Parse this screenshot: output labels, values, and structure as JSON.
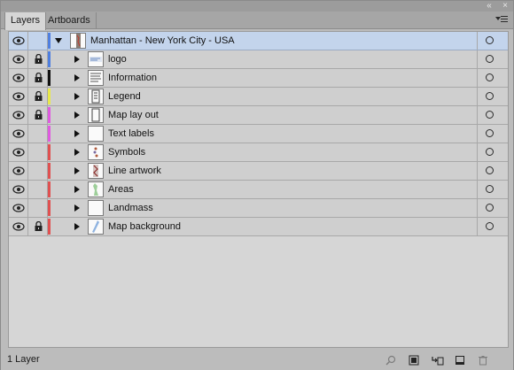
{
  "tabs": [
    {
      "label": "Layers",
      "active": true
    },
    {
      "label": "Artboards",
      "active": false
    }
  ],
  "title_buttons": {
    "collapse": "«",
    "close": "×"
  },
  "layers": [
    {
      "name": "Manhattan - New York City - USA",
      "visible": true,
      "locked": false,
      "color": "#4f7fe0",
      "expanded": true,
      "level": 0,
      "selected": true,
      "thumb": "map-tall-icon"
    },
    {
      "name": "logo",
      "visible": true,
      "locked": true,
      "color": "#4f7fe0",
      "expanded": false,
      "level": 1,
      "thumb": "logo-icon"
    },
    {
      "name": "Information",
      "visible": true,
      "locked": true,
      "color": "#111111",
      "expanded": false,
      "level": 1,
      "thumb": "text-doc-icon"
    },
    {
      "name": "Legend",
      "visible": true,
      "locked": true,
      "color": "#e8e84a",
      "expanded": false,
      "level": 1,
      "thumb": "legend-icon"
    },
    {
      "name": "Map lay out",
      "visible": true,
      "locked": true,
      "color": "#e05ae0",
      "expanded": false,
      "level": 1,
      "thumb": "frame-icon"
    },
    {
      "name": "Text labels",
      "visible": true,
      "locked": false,
      "color": "#e05ae0",
      "expanded": false,
      "level": 1,
      "thumb": "blank-icon"
    },
    {
      "name": "Symbols",
      "visible": true,
      "locked": false,
      "color": "#e05050",
      "expanded": false,
      "level": 1,
      "thumb": "symbols-icon"
    },
    {
      "name": "Line artwork",
      "visible": true,
      "locked": false,
      "color": "#e05050",
      "expanded": false,
      "level": 1,
      "thumb": "line-art-icon"
    },
    {
      "name": "Areas",
      "visible": true,
      "locked": false,
      "color": "#e05050",
      "expanded": false,
      "level": 1,
      "thumb": "areas-icon"
    },
    {
      "name": "Landmass",
      "visible": true,
      "locked": false,
      "color": "#e05050",
      "expanded": false,
      "level": 1,
      "thumb": "blank-icon"
    },
    {
      "name": "Map background",
      "visible": true,
      "locked": true,
      "color": "#e05050",
      "expanded": false,
      "level": 1,
      "thumb": "map-bg-icon"
    }
  ],
  "status": {
    "text": "1 Layer"
  },
  "footer_icons": [
    "locate-object-icon",
    "make-clipping-mask-icon",
    "create-sublayer-icon",
    "new-layer-icon",
    "delete-icon"
  ]
}
